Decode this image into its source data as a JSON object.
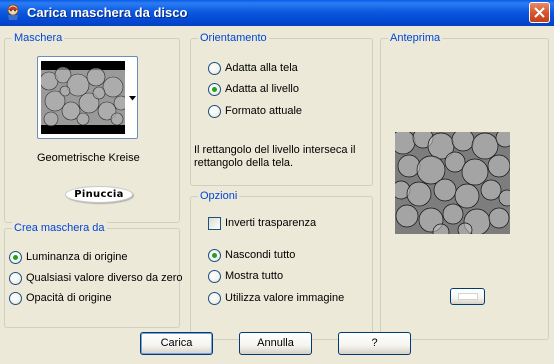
{
  "window": {
    "title": "Carica maschera da disco"
  },
  "mask_group": {
    "label": "Maschera",
    "selected_mask_name": "Geometrische Kreise",
    "watermark_text": "Pinuccia"
  },
  "source_group": {
    "label": "Crea maschera da",
    "options": [
      {
        "label": "Luminanza di origine",
        "checked": true
      },
      {
        "label": "Qualsiasi valore diverso da zero",
        "checked": false
      },
      {
        "label": "Opacità di origine",
        "checked": false
      }
    ]
  },
  "orientation_group": {
    "label": "Orientamento",
    "options": [
      {
        "label": "Adatta alla tela",
        "checked": false
      },
      {
        "label": "Adatta al livello",
        "checked": true
      },
      {
        "label": "Formato attuale",
        "checked": false
      }
    ],
    "info_text_line1": "Il rettangolo del livello interseca il",
    "info_text_line2": "rettangolo della tela."
  },
  "options_group": {
    "label": "Opzioni",
    "invert_label": "Inverti trasparenza",
    "invert_checked": false,
    "options": [
      {
        "label": "Nascondi tutto",
        "checked": true
      },
      {
        "label": "Mostra tutto",
        "checked": false
      },
      {
        "label": "Utilizza valore immagine",
        "checked": false
      }
    ]
  },
  "preview_group": {
    "label": "Anteprima"
  },
  "buttons": {
    "load": "Carica",
    "cancel": "Annulla",
    "help": "?"
  }
}
